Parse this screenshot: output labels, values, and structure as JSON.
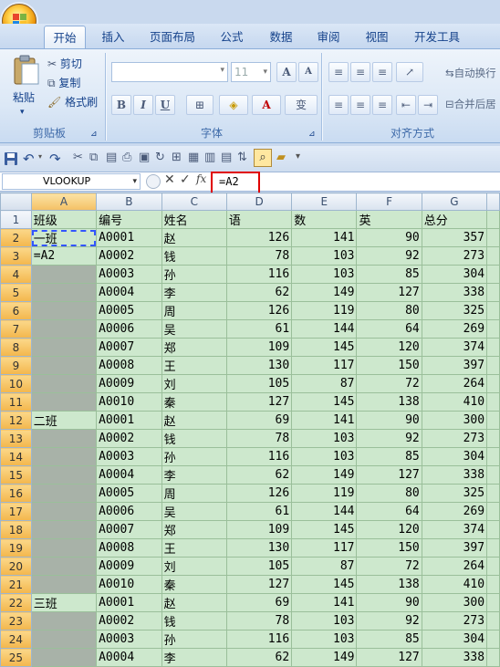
{
  "ribbon": {
    "tabs": [
      "开始",
      "插入",
      "页面布局",
      "公式",
      "数据",
      "审阅",
      "视图",
      "开发工具"
    ],
    "active_tab": "开始",
    "clipboard": {
      "paste": "粘贴",
      "cut": "剪切",
      "copy": "复制",
      "format_painter": "格式刷",
      "label": "剪贴板"
    },
    "font": {
      "name_value": "",
      "size_value": "11",
      "label": "字体",
      "bold": "B",
      "italic": "I",
      "underline": "U",
      "grow": "A",
      "shrink": "A",
      "phonetic": "变"
    },
    "alignment": {
      "label": "对齐方式",
      "wrap": "自动换行",
      "merge": "合并后居"
    }
  },
  "formula_bar": {
    "name_box": "VLOOKUP",
    "fx": "fx",
    "formula": "=A2"
  },
  "columns": [
    "A",
    "B",
    "C",
    "D",
    "E",
    "F",
    "G"
  ],
  "active_column": "A",
  "rows": [
    {
      "n": "1",
      "a": "班级",
      "b": "编号",
      "c": "姓名",
      "d": "语",
      "e": "数",
      "f": "英",
      "g": "总分"
    },
    {
      "n": "2",
      "a": "一班",
      "b": "A0001",
      "c": "赵",
      "d": "126",
      "e": "141",
      "f": "90",
      "g": "357"
    },
    {
      "n": "3",
      "a": "=A2",
      "b": "A0002",
      "c": "钱",
      "d": "78",
      "e": "103",
      "f": "92",
      "g": "273"
    },
    {
      "n": "4",
      "a": "",
      "b": "A0003",
      "c": "孙",
      "d": "116",
      "e": "103",
      "f": "85",
      "g": "304"
    },
    {
      "n": "5",
      "a": "",
      "b": "A0004",
      "c": "李",
      "d": "62",
      "e": "149",
      "f": "127",
      "g": "338"
    },
    {
      "n": "6",
      "a": "",
      "b": "A0005",
      "c": "周",
      "d": "126",
      "e": "119",
      "f": "80",
      "g": "325"
    },
    {
      "n": "7",
      "a": "",
      "b": "A0006",
      "c": "吴",
      "d": "61",
      "e": "144",
      "f": "64",
      "g": "269"
    },
    {
      "n": "8",
      "a": "",
      "b": "A0007",
      "c": "郑",
      "d": "109",
      "e": "145",
      "f": "120",
      "g": "374"
    },
    {
      "n": "9",
      "a": "",
      "b": "A0008",
      "c": "王",
      "d": "130",
      "e": "117",
      "f": "150",
      "g": "397"
    },
    {
      "n": "10",
      "a": "",
      "b": "A0009",
      "c": "刘",
      "d": "105",
      "e": "87",
      "f": "72",
      "g": "264"
    },
    {
      "n": "11",
      "a": "",
      "b": "A0010",
      "c": "秦",
      "d": "127",
      "e": "145",
      "f": "138",
      "g": "410"
    },
    {
      "n": "12",
      "a": "二班",
      "b": "A0001",
      "c": "赵",
      "d": "69",
      "e": "141",
      "f": "90",
      "g": "300"
    },
    {
      "n": "13",
      "a": "",
      "b": "A0002",
      "c": "钱",
      "d": "78",
      "e": "103",
      "f": "92",
      "g": "273"
    },
    {
      "n": "14",
      "a": "",
      "b": "A0003",
      "c": "孙",
      "d": "116",
      "e": "103",
      "f": "85",
      "g": "304"
    },
    {
      "n": "15",
      "a": "",
      "b": "A0004",
      "c": "李",
      "d": "62",
      "e": "149",
      "f": "127",
      "g": "338"
    },
    {
      "n": "16",
      "a": "",
      "b": "A0005",
      "c": "周",
      "d": "126",
      "e": "119",
      "f": "80",
      "g": "325"
    },
    {
      "n": "17",
      "a": "",
      "b": "A0006",
      "c": "吴",
      "d": "61",
      "e": "144",
      "f": "64",
      "g": "269"
    },
    {
      "n": "18",
      "a": "",
      "b": "A0007",
      "c": "郑",
      "d": "109",
      "e": "145",
      "f": "120",
      "g": "374"
    },
    {
      "n": "19",
      "a": "",
      "b": "A0008",
      "c": "王",
      "d": "130",
      "e": "117",
      "f": "150",
      "g": "397"
    },
    {
      "n": "20",
      "a": "",
      "b": "A0009",
      "c": "刘",
      "d": "105",
      "e": "87",
      "f": "72",
      "g": "264"
    },
    {
      "n": "21",
      "a": "",
      "b": "A0010",
      "c": "秦",
      "d": "127",
      "e": "145",
      "f": "138",
      "g": "410"
    },
    {
      "n": "22",
      "a": "三班",
      "b": "A0001",
      "c": "赵",
      "d": "69",
      "e": "141",
      "f": "90",
      "g": "300"
    },
    {
      "n": "23",
      "a": "",
      "b": "A0002",
      "c": "钱",
      "d": "78",
      "e": "103",
      "f": "92",
      "g": "273"
    },
    {
      "n": "24",
      "a": "",
      "b": "A0003",
      "c": "孙",
      "d": "116",
      "e": "103",
      "f": "85",
      "g": "304"
    },
    {
      "n": "25",
      "a": "",
      "b": "A0004",
      "c": "李",
      "d": "62",
      "e": "149",
      "f": "127",
      "g": "338"
    }
  ],
  "selected_rows": [
    "2",
    "3",
    "4",
    "5",
    "6",
    "7",
    "8",
    "9",
    "10",
    "11",
    "12",
    "13",
    "14",
    "15",
    "16",
    "17",
    "18",
    "19",
    "20",
    "21",
    "22",
    "23",
    "24",
    "25"
  ],
  "colors": {
    "cell_fill": "#cde8cd",
    "empty_fill": "#a8b2a8",
    "highlight": "#e00000"
  }
}
